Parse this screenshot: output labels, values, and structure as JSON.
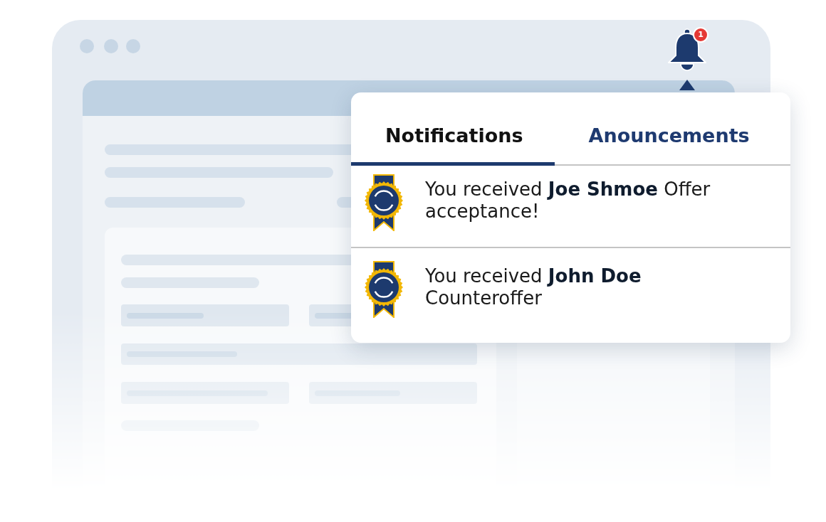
{
  "bell": {
    "badge": "1"
  },
  "popup": {
    "tabs": [
      {
        "label": "Notifications",
        "selected": true
      },
      {
        "label": "Anouncements",
        "selected": false
      }
    ],
    "notifications": [
      {
        "text": "You received **Joe Shmoe** Offer acceptance!"
      },
      {
        "text": "You received **John Doe** Counteroffer"
      }
    ]
  }
}
